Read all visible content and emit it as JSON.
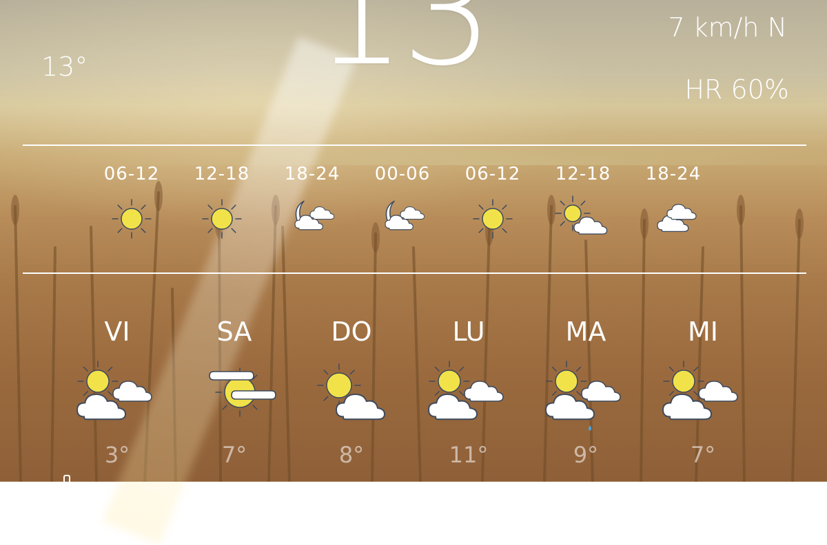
{
  "current": {
    "temperature": "13",
    "degree_symbol": "°",
    "feels_like": "13°",
    "wind": "7 km/h N",
    "humidity": "HR 60%"
  },
  "hourly": [
    {
      "time": "06-12",
      "icon": "sun-icon"
    },
    {
      "time": "12-18",
      "icon": "sun-icon"
    },
    {
      "time": "18-24",
      "icon": "moon-clouds-icon"
    },
    {
      "time": "00-06",
      "icon": "moon-clouds-icon"
    },
    {
      "time": "06-12",
      "icon": "sun-icon"
    },
    {
      "time": "12-18",
      "icon": "sun-cloud-icon"
    },
    {
      "time": "18-24",
      "icon": "clouds-icon"
    }
  ],
  "daily": [
    {
      "day": "VI",
      "temp": "3°",
      "icon": "sun-clouds-icon"
    },
    {
      "day": "SA",
      "temp": "7°",
      "icon": "sun-fog-icon"
    },
    {
      "day": "DO",
      "temp": "8°",
      "icon": "sun-cloud-icon"
    },
    {
      "day": "LU",
      "temp": "11°",
      "icon": "sun-clouds-icon"
    },
    {
      "day": "MA",
      "temp": "9°",
      "icon": "sun-clouds-drizzle-icon"
    },
    {
      "day": "MI",
      "temp": "7°",
      "icon": "sun-clouds-icon"
    }
  ],
  "colors": {
    "sun": "#f2e24a",
    "cloud_fill": "#ffffff",
    "icon_stroke": "#3d4a5c",
    "rain": "#4aa3df"
  }
}
